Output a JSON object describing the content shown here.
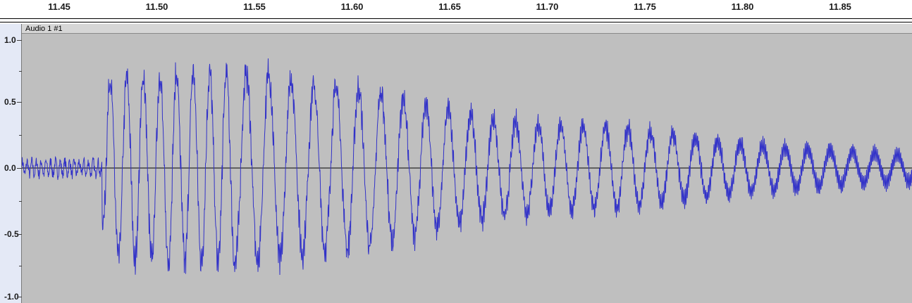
{
  "timeline": {
    "ticks": [
      "11.45",
      "11.50",
      "11.55",
      "11.60",
      "11.65",
      "11.70",
      "11.75",
      "11.80",
      "11.85"
    ]
  },
  "track": {
    "name": "Audio 1 #1"
  },
  "amplitude_scale": {
    "labels": [
      "1.0",
      "0.5",
      "0.0",
      "-0.5",
      "-1.0"
    ]
  },
  "colors": {
    "waveform": "#3232c8",
    "wave_background": "#bfbfbf",
    "zero_line": "#000000",
    "vertical_ruler_bg": "#e4e9f6"
  },
  "waveform": {
    "envelope": [
      [
        11.432,
        0.08
      ],
      [
        11.47,
        0.08
      ],
      [
        11.474,
        0.68
      ],
      [
        11.52,
        0.72
      ],
      [
        11.56,
        0.72
      ],
      [
        11.58,
        0.62
      ],
      [
        11.61,
        0.6
      ],
      [
        11.64,
        0.48
      ],
      [
        11.66,
        0.4
      ],
      [
        11.7,
        0.32
      ],
      [
        11.74,
        0.3
      ],
      [
        11.78,
        0.22
      ],
      [
        11.82,
        0.16
      ],
      [
        11.86,
        0.12
      ],
      [
        11.888,
        0.1
      ]
    ]
  }
}
